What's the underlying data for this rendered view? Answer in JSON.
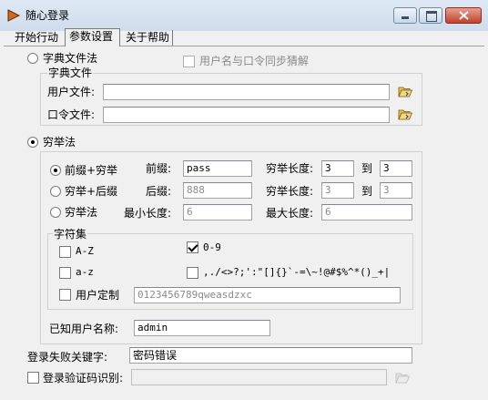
{
  "window": {
    "title": "随心登录"
  },
  "tabs": [
    {
      "label": "开始行动"
    },
    {
      "label": "参数设置"
    },
    {
      "label": "关于帮助"
    }
  ],
  "dictionary": {
    "radio_label": "字典文件法",
    "sync_label": "用户名与口令同步猜解",
    "group_title": "字典文件",
    "user_file_label": "用户文件:",
    "user_file_value": "",
    "pass_file_label": "口令文件:",
    "pass_file_value": ""
  },
  "exhaustive": {
    "radio_label": "穷举法",
    "prefix_mode_label": "前缀+穷举",
    "suffix_mode_label": "穷举+后缀",
    "plain_mode_label": "穷举法",
    "prefix_label": "前缀:",
    "prefix_value": "pass",
    "suffix_label": "后缀:",
    "suffix_value": "888",
    "min_len_label": "最小长度:",
    "min_len_value": "6",
    "len1_label": "穷举长度:",
    "len1_from": "3",
    "len1_to_label": "到",
    "len1_to": "3",
    "len2_label": "穷举长度:",
    "len2_from": "3",
    "len2_to_label": "到",
    "len2_to": "3",
    "max_len_label": "最大长度:",
    "max_len_value": "6"
  },
  "charset": {
    "group_title": "字符集",
    "az_upper": "A-Z",
    "digits": "0-9",
    "az_lower": "a-z",
    "symbols": ",./<>?;':\"[]{}`-=\\~!@#$%^*()_+|",
    "custom_label": "用户定制",
    "custom_value": "0123456789qweasdzxc"
  },
  "known_user": {
    "label": "已知用户名称:",
    "value": "admin"
  },
  "fail_keyword": {
    "label": "登录失败关键字:",
    "value": "密码错误"
  },
  "captcha": {
    "label": "登录验证码识别:",
    "value": ""
  }
}
